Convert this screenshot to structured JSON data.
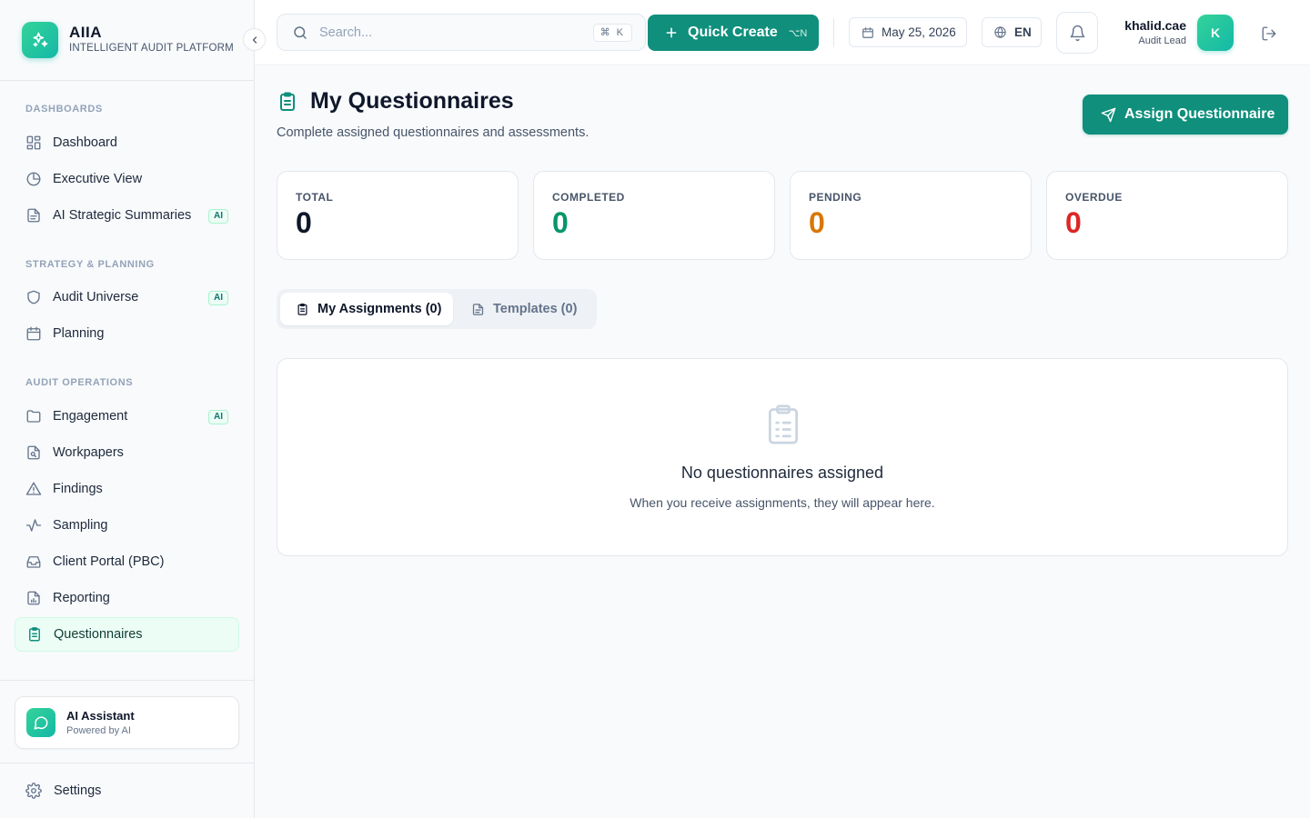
{
  "brand": {
    "name": "AIIA",
    "subtitle": "INTELLIGENT AUDIT PLATFORM"
  },
  "sidebar": {
    "sections": [
      {
        "title": "DASHBOARDS"
      },
      {
        "title": "STRATEGY & PLANNING"
      },
      {
        "title": "AUDIT OPERATIONS"
      }
    ],
    "items": [
      {
        "label": "Dashboard",
        "icon": "layout-grid-icon"
      },
      {
        "label": "Executive View",
        "icon": "pie-chart-icon"
      },
      {
        "label": "AI Strategic Summaries",
        "icon": "file-text-icon",
        "badge": "AI"
      },
      {
        "label": "Audit Universe",
        "icon": "shield-icon",
        "badge": "AI"
      },
      {
        "label": "Planning",
        "icon": "calendar-icon"
      },
      {
        "label": "Engagement",
        "icon": "folder-icon",
        "badge": "AI"
      },
      {
        "label": "Workpapers",
        "icon": "file-search-icon"
      },
      {
        "label": "Findings",
        "icon": "alert-triangle-icon"
      },
      {
        "label": "Sampling",
        "icon": "activity-icon"
      },
      {
        "label": "Client Portal (PBC)",
        "icon": "inbox-icon"
      },
      {
        "label": "Reporting",
        "icon": "file-bar-chart-icon"
      },
      {
        "label": "Questionnaires",
        "icon": "clipboard-list-icon",
        "active": true
      }
    ],
    "assistant": {
      "title": "AI Assistant",
      "subtitle": "Powered by AI"
    },
    "settings_label": "Settings"
  },
  "topbar": {
    "search_placeholder": "Search...",
    "search_shortcut": "⌘ K",
    "quick_create_label": "Quick Create",
    "quick_create_shortcut": "⌥N",
    "date": "May 25, 2026",
    "language": "EN",
    "user": {
      "name": "khalid.cae",
      "role": "Audit Lead",
      "initial": "K"
    }
  },
  "page": {
    "title": "My Questionnaires",
    "subtitle": "Complete assigned questionnaires and assessments.",
    "assign_button": "Assign Questionnaire"
  },
  "stats": [
    {
      "label": "TOTAL",
      "value": "0",
      "color": "#0f172a"
    },
    {
      "label": "COMPLETED",
      "value": "0",
      "color": "#059669"
    },
    {
      "label": "PENDING",
      "value": "0",
      "color": "#d97706"
    },
    {
      "label": "OVERDUE",
      "value": "0",
      "color": "#dc2626"
    }
  ],
  "tabs": [
    {
      "label": "My Assignments (0)",
      "active": true
    },
    {
      "label": "Templates (0)",
      "active": false
    }
  ],
  "empty_state": {
    "title": "No questionnaires assigned",
    "message": "When you receive assignments, they will appear here."
  },
  "colors": {
    "accent": "#0f8f7c",
    "accent_light": "#ecfdf5",
    "gradient_start": "#34d399",
    "gradient_end": "#14b8a6"
  }
}
